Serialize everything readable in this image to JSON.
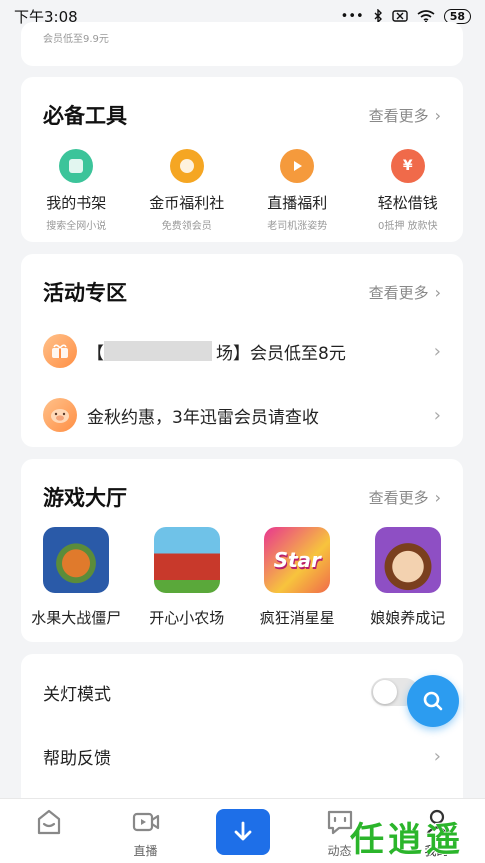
{
  "status_bar": {
    "time": "下午3:08",
    "battery": "58"
  },
  "top_card": {
    "sub_text": "会员低至9.9元"
  },
  "tools_section": {
    "title": "必备工具",
    "more": "查看更多",
    "items": [
      {
        "name": "我的书架",
        "sub": "搜索全网小说",
        "color": "#3cc49a",
        "icon": "bookshelf-icon"
      },
      {
        "name": "金币福利社",
        "sub": "免费领会员",
        "color": "#f5a623",
        "icon": "coin-icon"
      },
      {
        "name": "直播福利",
        "sub": "老司机涨姿势",
        "color": "#f59a3c",
        "icon": "live-icon"
      },
      {
        "name": "轻松借钱",
        "sub": "0抵押 放款快",
        "color": "#f06a4a",
        "icon": "loan-icon"
      }
    ]
  },
  "activity_section": {
    "title": "活动专区",
    "more": "查看更多",
    "items": [
      {
        "prefix": "【",
        "suffix": "场】会员低至8元"
      },
      {
        "text": "金秋约惠，3年迅雷会员请查收"
      }
    ]
  },
  "games_section": {
    "title": "游戏大厅",
    "more": "查看更多",
    "items": [
      {
        "name": "水果大战僵尸",
        "colors": [
          "#2a5aa8",
          "#e07a2c"
        ]
      },
      {
        "name": "开心小农场",
        "colors": [
          "#6fc2e8",
          "#c8392b"
        ]
      },
      {
        "name": "疯狂消星星",
        "colors": [
          "#e8368f",
          "#f7c43d"
        ],
        "badge": "Star"
      },
      {
        "name": "娘娘养成记",
        "colors": [
          "#8e4fc4",
          "#f3d2b0"
        ]
      }
    ]
  },
  "settings_section": {
    "items": [
      {
        "label": "关灯模式",
        "control": "toggle",
        "value": "off"
      },
      {
        "label": "帮助反馈",
        "control": "chevron"
      }
    ]
  },
  "tab_bar": {
    "items": [
      {
        "label": "",
        "icon": "home-icon"
      },
      {
        "label": "直播",
        "icon": "video-icon"
      },
      {
        "label": "",
        "icon": "download-icon"
      },
      {
        "label": "动态",
        "icon": "chat-icon"
      },
      {
        "label": "我的",
        "icon": "profile-icon"
      }
    ]
  },
  "watermark": "任逍遥"
}
